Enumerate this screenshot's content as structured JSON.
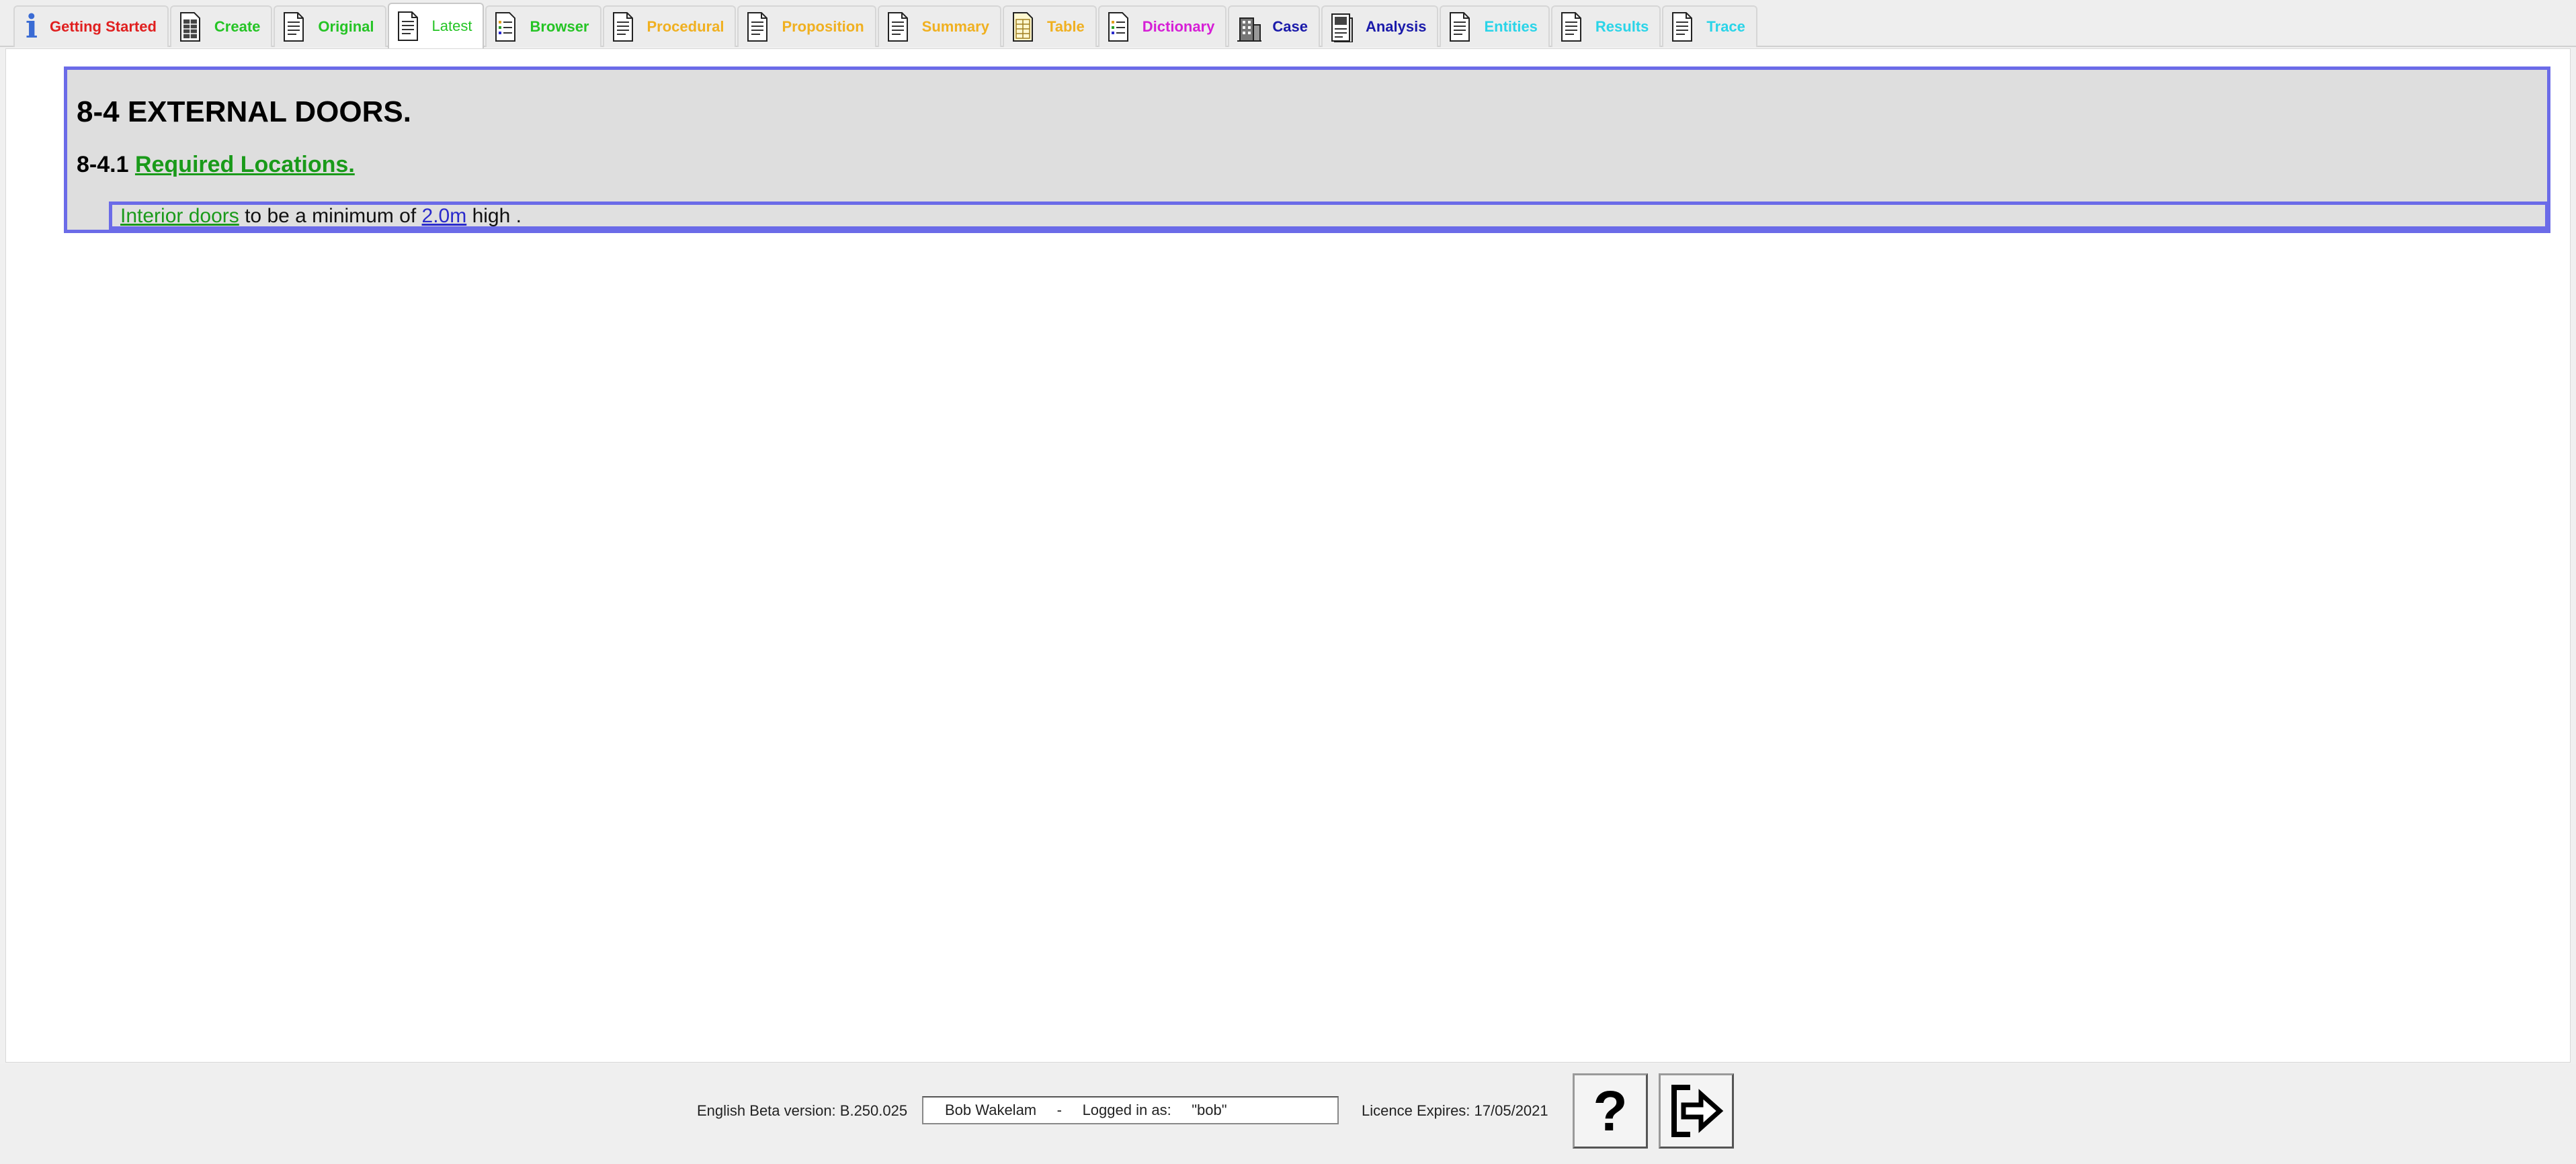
{
  "tabs": [
    {
      "label": "Getting Started",
      "color": "#e01f1f",
      "icon": "info-icon"
    },
    {
      "label": "Create",
      "color": "#25c425",
      "icon": "document-grid-icon"
    },
    {
      "label": "Original",
      "color": "#25c425",
      "icon": "document-icon"
    },
    {
      "label": "Latest",
      "color": "#25c425",
      "icon": "document-icon",
      "selected": true
    },
    {
      "label": "Browser",
      "color": "#25c425",
      "icon": "document-list-icon"
    },
    {
      "label": "Procedural",
      "color": "#f0b020",
      "icon": "document-icon"
    },
    {
      "label": "Proposition",
      "color": "#f0b020",
      "icon": "document-icon"
    },
    {
      "label": "Summary",
      "color": "#f0b020",
      "icon": "document-icon"
    },
    {
      "label": "Table",
      "color": "#f0b020",
      "icon": "document-table-icon"
    },
    {
      "label": "Dictionary",
      "color": "#d61fd6",
      "icon": "document-list-icon"
    },
    {
      "label": "Case",
      "color": "#1a1aaa",
      "icon": "building-icon"
    },
    {
      "label": "Analysis",
      "color": "#1a1aaa",
      "icon": "document-chart-icon"
    },
    {
      "label": "Entities",
      "color": "#2ad4e8",
      "icon": "document-icon"
    },
    {
      "label": "Results",
      "color": "#2ad4e8",
      "icon": "document-icon"
    },
    {
      "label": "Trace",
      "color": "#2ad4e8",
      "icon": "document-icon"
    }
  ],
  "document": {
    "section_title": "8-4 EXTERNAL DOORS.",
    "subsection_number": "8-4.1",
    "subsection_link": "Required Locations.",
    "clause": {
      "link1": "Interior doors",
      "text1": " to be a minimum of ",
      "link2": "2.0m",
      "text2": " high ."
    }
  },
  "status": {
    "version": "English Beta version: B.250.025",
    "user": "Bob Wakelam     -     Logged in as:     \"bob\"",
    "licence": "Licence Expires: 17/05/2021"
  },
  "colors": {
    "border_accent": "#6b6be8",
    "link_green": "#1a9a1a",
    "link_blue": "#2a2acc"
  }
}
